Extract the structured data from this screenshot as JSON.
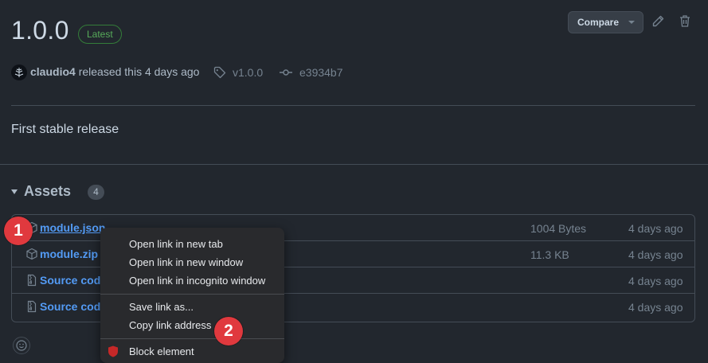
{
  "release": {
    "title": "1.0.0",
    "badge": "Latest",
    "compare_label": "Compare",
    "author": "claudio4",
    "released_text": "released this 4 days ago",
    "tag": "v1.0.0",
    "commit": "e3934b7",
    "body": "First stable release"
  },
  "assets": {
    "heading": "Assets",
    "count": "4",
    "rows": [
      {
        "name": "module.json",
        "size": "1004 Bytes",
        "date": "4 days ago",
        "icon": "package-icon"
      },
      {
        "name": "module.zip",
        "size": "11.3 KB",
        "date": "4 days ago",
        "icon": "package-icon"
      },
      {
        "name": "Source code",
        "size": "",
        "date": "4 days ago",
        "icon": "file-zip-icon"
      },
      {
        "name": "Source code",
        "size": "",
        "date": "4 days ago",
        "icon": "file-zip-icon"
      }
    ]
  },
  "context_menu": {
    "items": [
      "Open link in new tab",
      "Open link in new window",
      "Open link in incognito window",
      "Save link as...",
      "Copy link address",
      "Block element"
    ]
  },
  "markers": [
    "1",
    "2"
  ],
  "colors": {
    "background": "#22272e",
    "link": "#539bf5",
    "latest_badge": "#57ab5a",
    "marker": "#e0393e",
    "menu_bg": "#292a2d"
  }
}
